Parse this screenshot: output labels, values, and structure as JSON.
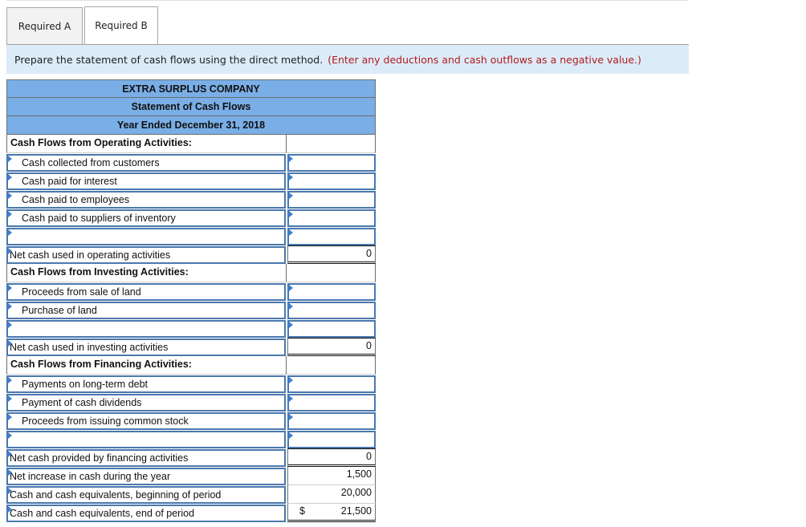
{
  "tabs": [
    {
      "label": "Required A",
      "active": false
    },
    {
      "label": "Required B",
      "active": true
    }
  ],
  "instruction": {
    "text": "Prepare the statement of cash flows using the direct method.",
    "note": "(Enter any deductions and cash outflows as a negative value.)"
  },
  "statement": {
    "company": "EXTRA SURPLUS COMPANY",
    "title": "Statement of Cash Flows",
    "period": "Year Ended December 31, 2018",
    "operating": {
      "heading": "Cash Flows from Operating Activities:",
      "items": [
        {
          "label": "Cash collected from customers",
          "value": ""
        },
        {
          "label": "Cash paid for interest",
          "value": ""
        },
        {
          "label": "Cash paid to employees",
          "value": ""
        },
        {
          "label": "Cash paid to suppliers of inventory",
          "value": ""
        },
        {
          "label": "",
          "value": ""
        }
      ],
      "total_label": "Net cash used in operating activities",
      "total_value": "0"
    },
    "investing": {
      "heading": "Cash Flows from Investing Activities:",
      "items": [
        {
          "label": "Proceeds from sale of land",
          "value": ""
        },
        {
          "label": "Purchase of land",
          "value": ""
        },
        {
          "label": "",
          "value": ""
        }
      ],
      "total_label": "Net cash used in investing activities",
      "total_value": "0"
    },
    "financing": {
      "heading": "Cash Flows from Financing Activities:",
      "items": [
        {
          "label": "Payments on long-term debt",
          "value": ""
        },
        {
          "label": "Payment of cash dividends",
          "value": ""
        },
        {
          "label": "Proceeds from issuing common stock",
          "value": ""
        },
        {
          "label": "",
          "value": ""
        }
      ],
      "total_label": "Net cash provided by financing activities",
      "total_value": "0"
    },
    "summary": [
      {
        "label": "Net increase in cash during the year",
        "value": "1,500",
        "currency": ""
      },
      {
        "label": "Cash and cash equivalents, beginning of period",
        "value": "20,000",
        "currency": ""
      },
      {
        "label": "Cash and cash equivalents, end of period",
        "value": "21,500",
        "currency": "$"
      }
    ]
  }
}
